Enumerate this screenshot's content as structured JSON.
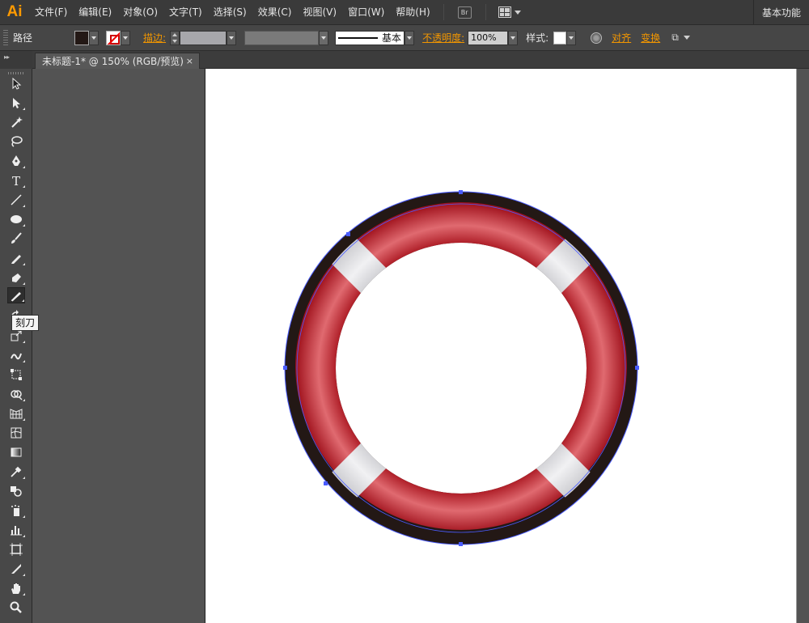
{
  "app": {
    "logo": "Ai",
    "workspace": "基本功能"
  },
  "menu": {
    "items": [
      "文件(F)",
      "编辑(E)",
      "对象(O)",
      "文字(T)",
      "选择(S)",
      "效果(C)",
      "视图(V)",
      "窗口(W)",
      "帮助(H)"
    ],
    "bridge_label": "Br"
  },
  "control_bar": {
    "selection_type": "路径",
    "stroke_label": "描边:",
    "profile_label": "基本",
    "opacity_label": "不透明度:",
    "opacity_value": "100%",
    "style_label": "样式:",
    "align_label": "对齐",
    "transform_label": "变换",
    "fill_color": "#231815"
  },
  "document": {
    "tab_title": "未标题-1* @ 150% (RGB/预览)",
    "close_glyph": "×"
  },
  "toolbar": {
    "tools": [
      "selection-tool",
      "direct-selection-tool",
      "magic-wand-tool",
      "lasso-tool",
      "pen-tool",
      "type-tool",
      "line-segment-tool",
      "ellipse-tool",
      "paintbrush-tool",
      "pencil-tool",
      "blob-brush-tool",
      "eraser-tool",
      "rotate-tool",
      "scale-tool",
      "warp-tool",
      "free-transform-tool",
      "shape-builder-tool",
      "perspective-grid-tool",
      "mesh-tool",
      "gradient-tool",
      "eyedropper-tool",
      "blend-tool",
      "symbol-sprayer-tool",
      "column-graph-tool",
      "artboard-tool",
      "slice-tool",
      "hand-tool",
      "zoom-tool"
    ],
    "active_tool": "eraser-tool",
    "tooltip": "刻刀"
  },
  "artwork": {
    "outer_ring_color": "#231815",
    "ring_color": "#c8323a",
    "band_color": "#e4e4e6",
    "path_color": "#4a5cff"
  }
}
